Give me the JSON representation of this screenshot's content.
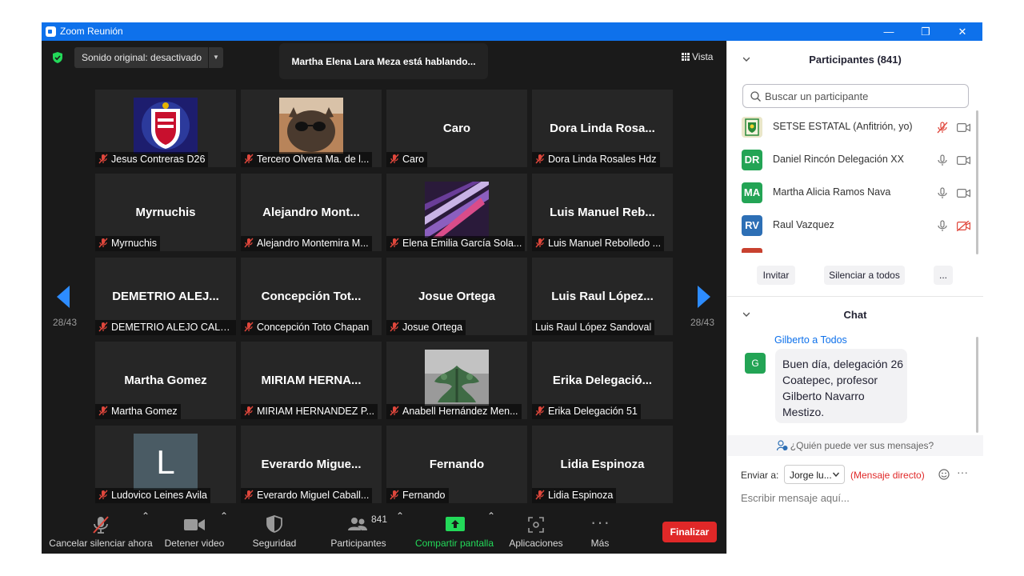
{
  "window": {
    "title": "Zoom Reunión"
  },
  "top": {
    "audio_label": "Sonido original: desactivado",
    "speaking": "Martha Elena Lara Meza está hablando...",
    "view_label": "Vista"
  },
  "pager": {
    "left": "28/43",
    "right": "28/43"
  },
  "tiles": [
    {
      "title": "",
      "name": "Jesus Contreras D26",
      "muted": true
    },
    {
      "title": "",
      "name": "Tercero Olvera Ma. de l...",
      "muted": true
    },
    {
      "title": "Caro",
      "name": "Caro",
      "muted": true
    },
    {
      "title": "Dora Linda Rosa...",
      "name": "Dora Linda Rosales Hdz",
      "muted": true
    },
    {
      "title": "Myrnuchis",
      "name": "Myrnuchis",
      "muted": true
    },
    {
      "title": "Alejandro Mont...",
      "name": "Alejandro Montemira M...",
      "muted": true
    },
    {
      "title": "",
      "name": "Elena Emilia García Sola...",
      "muted": true
    },
    {
      "title": "Luis Manuel Reb...",
      "name": "Luis Manuel Rebolledo ...",
      "muted": true
    },
    {
      "title": "DEMETRIO ALEJ...",
      "name": "DEMETRIO ALEJO CALD...",
      "muted": true
    },
    {
      "title": "Concepción Tot...",
      "name": "Concepción Toto Chapan",
      "muted": true
    },
    {
      "title": "Josue Ortega",
      "name": "Josue Ortega",
      "muted": true
    },
    {
      "title": "Luis Raul López...",
      "name": "Luis Raul López Sandoval",
      "muted": false
    },
    {
      "title": "Martha Gomez",
      "name": "Martha Gomez",
      "muted": true
    },
    {
      "title": "MIRIAM HERNA...",
      "name": "MIRIAM HERNANDEZ P...",
      "muted": true
    },
    {
      "title": "",
      "name": "Anabell Hernández Men...",
      "muted": true
    },
    {
      "title": "Erika Delegació...",
      "name": "Erika Delegación 51",
      "muted": true
    },
    {
      "title": "",
      "name": "Ludovico Leines Avila",
      "muted": true,
      "initial": "L"
    },
    {
      "title": "Everardo Migue...",
      "name": "Everardo Miguel Caball...",
      "muted": true
    },
    {
      "title": "Fernando",
      "name": "Fernando",
      "muted": true
    },
    {
      "title": "Lidia Espinoza",
      "name": "Lidia Espinoza",
      "muted": true
    }
  ],
  "toolbar": {
    "unmute": "Cancelar silenciar ahora",
    "video": "Detener video",
    "security": "Seguridad",
    "participants": "Participantes",
    "participants_count": "841",
    "share": "Compartir pantalla",
    "apps": "Aplicaciones",
    "more": "Más",
    "end": "Finalizar"
  },
  "panel": {
    "participants_title": "Participantes (841)",
    "search_placeholder": "Buscar un participante",
    "participants": [
      {
        "initials": "",
        "name": "SETSE ESTATAL (Anfitrión, yo)",
        "color": "#e9e6c8"
      },
      {
        "initials": "DR",
        "name": "Daniel Rincón Delegación XX",
        "color": "#23a455"
      },
      {
        "initials": "MA",
        "name": "Martha Alicia Ramos Nava",
        "color": "#23a455"
      },
      {
        "initials": "RV",
        "name": "Raul Vazquez",
        "color": "#2d6fb5"
      }
    ],
    "invite": "Invitar",
    "mute_all": "Silenciar a todos",
    "more": "...",
    "chat_title": "Chat",
    "message": {
      "sender": "Gilberto a Todos",
      "initial": "G",
      "text": "Buen día, delegación 26 Coatepec, profesor Gilberto Navarro Mestizo."
    },
    "who_sees": "¿Quién puede ver sus mensajes?",
    "send_to_label": "Enviar a:",
    "recipient": "Jorge lu...",
    "direct": "(Mensaje directo)",
    "compose_placeholder": "Escribir mensaje aquí..."
  },
  "colors": {
    "zoom_blue": "#0e71eb",
    "share_green": "#23d959",
    "end_red": "#e02828",
    "mute_red": "#e0473c"
  }
}
